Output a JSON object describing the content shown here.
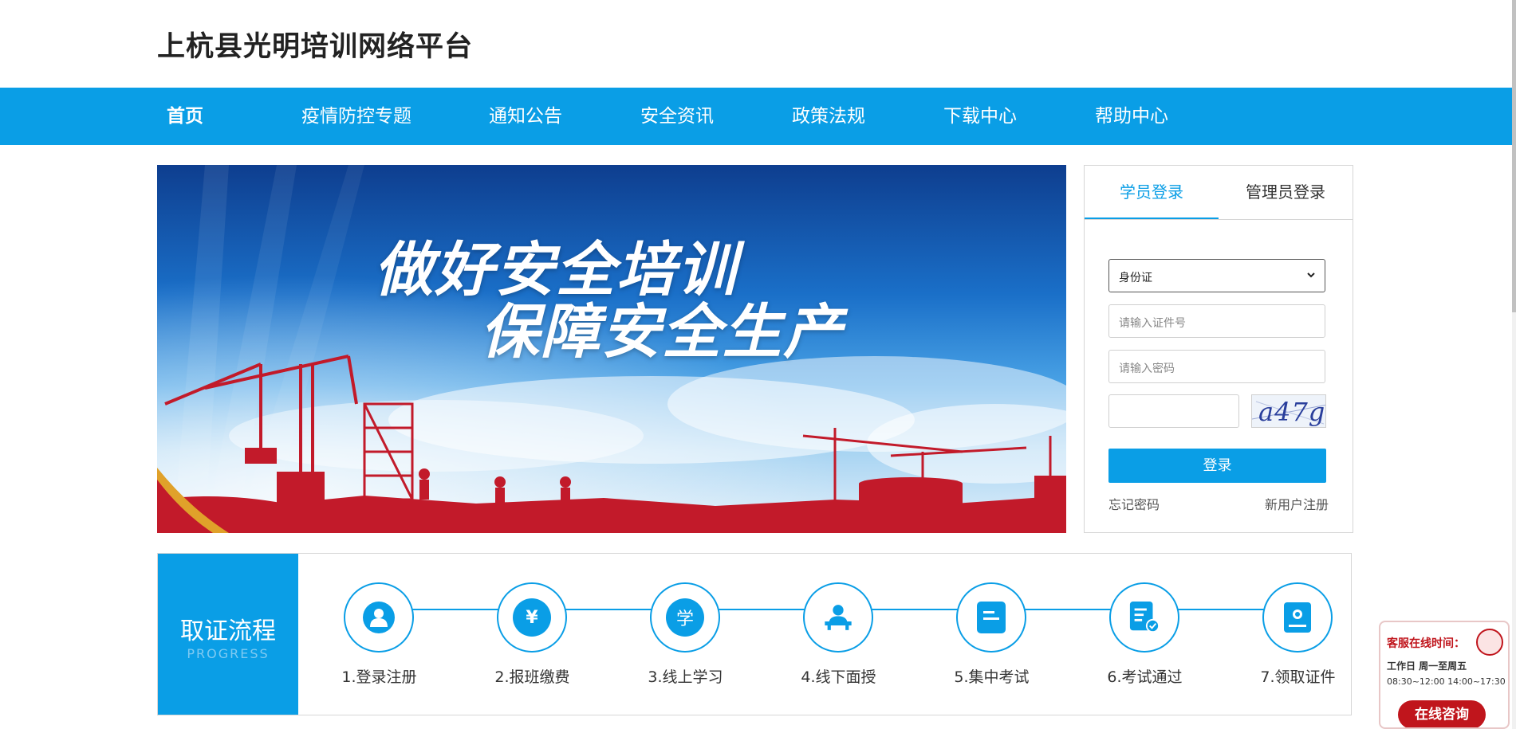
{
  "site": {
    "title": "上杭县光明培训网络平台"
  },
  "nav": {
    "items": [
      {
        "label": "首页"
      },
      {
        "label": "疫情防控专题"
      },
      {
        "label": "通知公告"
      },
      {
        "label": "安全资讯"
      },
      {
        "label": "政策法规"
      },
      {
        "label": "下载中心"
      },
      {
        "label": "帮助中心"
      }
    ]
  },
  "banner": {
    "line1": "做好安全培训",
    "line2": "保障安全生产"
  },
  "login": {
    "tabs": [
      {
        "label": "学员登录"
      },
      {
        "label": "管理员登录"
      }
    ],
    "id_type": "身份证",
    "id_placeholder": "请输入证件号",
    "password_placeholder": "请输入密码",
    "captcha_value": "",
    "captcha_text": "a47g",
    "submit_label": "登录",
    "forgot_label": "忘记密码",
    "register_label": "新用户注册"
  },
  "progress": {
    "title": "取证流程",
    "subtitle": "PROGRESS",
    "steps": [
      {
        "label": "1.登录注册",
        "icon": "user-icon"
      },
      {
        "label": "2.报班缴费",
        "icon": "yuan-icon"
      },
      {
        "label": "3.线上学习",
        "icon": "study-icon"
      },
      {
        "label": "4.线下面授",
        "icon": "classroom-icon"
      },
      {
        "label": "5.集中考试",
        "icon": "exam-paper-icon"
      },
      {
        "label": "6.考试通过",
        "icon": "checked-document-icon"
      },
      {
        "label": "7.领取证件",
        "icon": "certificate-icon"
      }
    ]
  },
  "service": {
    "title": "客服在线时间：",
    "hours_days": "工作日 周一至周五",
    "hours_time": "08:30~12:00 14:00~17:30",
    "button_label": "在线咨询"
  },
  "colors": {
    "primary": "#0a9ee6",
    "service_red": "#c0151c"
  }
}
